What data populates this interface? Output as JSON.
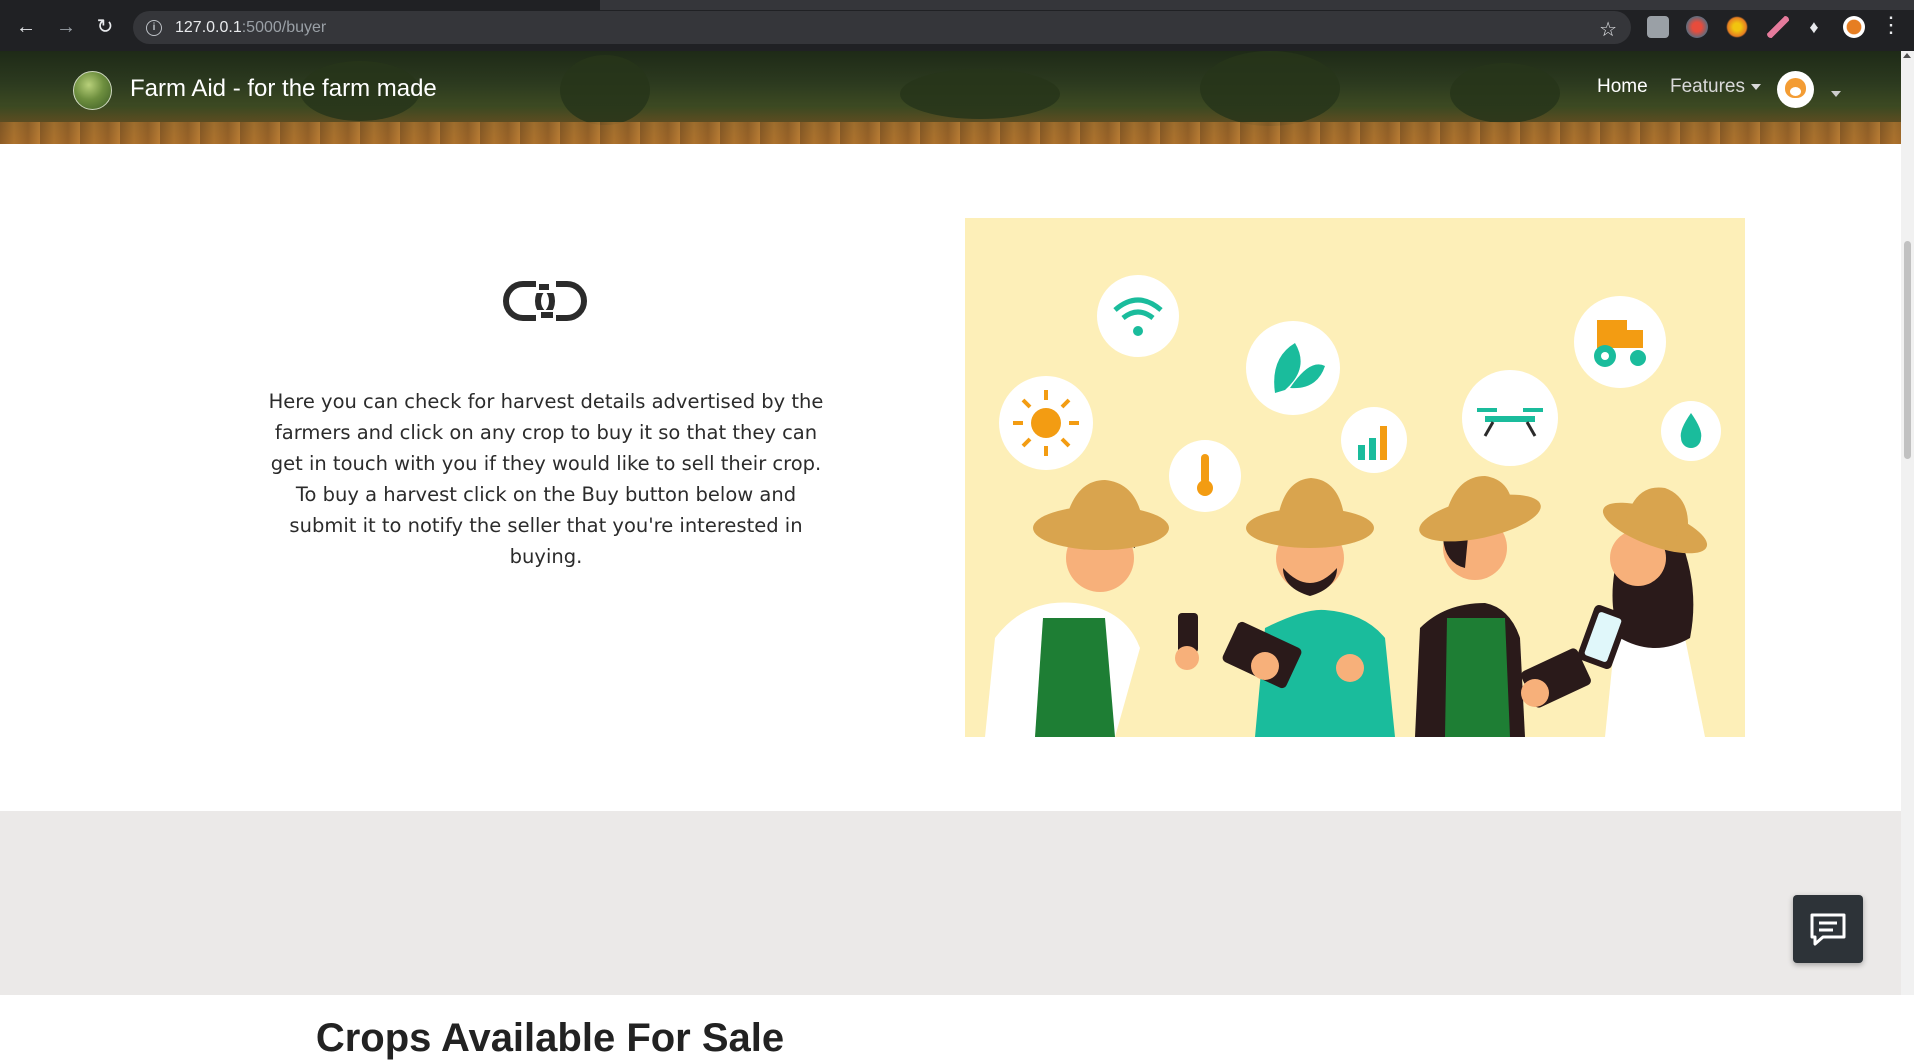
{
  "browser": {
    "url_host": "127.0.0.1",
    "url_rest": ":5000/buyer",
    "icons": [
      "back-arrow-icon",
      "forward-arrow-icon",
      "reload-icon",
      "info-icon",
      "star-icon",
      "extensions-puzzle-icon",
      "kebab-menu-icon"
    ]
  },
  "header": {
    "brand": "Farm Aid - for the farm made",
    "nav": {
      "home": "Home",
      "features": "Features"
    }
  },
  "info": {
    "icon": "link-icon",
    "text": "Here you can check for harvest details advertised by the farmers and click on any crop to buy it so that they can get in touch with you if they would like to sell their crop. To buy a harvest click on the Buy button below and submit it to notify the seller that you're interested in buying."
  },
  "next_section": {
    "heading": "Crops Available For Sale"
  },
  "colors": {
    "illustration_bg": "#fdefb8",
    "accent_teal": "#1abc9c",
    "accent_orange": "#f39c12",
    "grey_section": "#ebe9e8",
    "chat_button": "#2d3338"
  }
}
